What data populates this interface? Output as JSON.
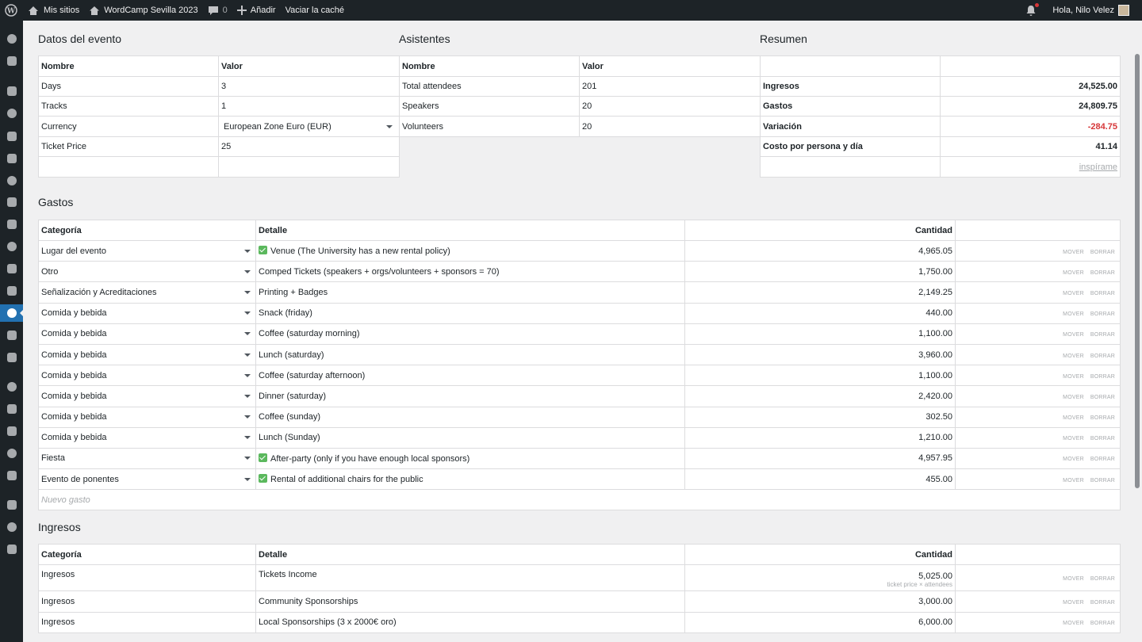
{
  "adminbar": {
    "my_sites": "Mis sitios",
    "site_name": "WordCamp Sevilla 2023",
    "comments_count": "0",
    "new_label": "Añadir",
    "flush_cache": "Vaciar la caché",
    "greeting": "Hola, Nilo Velez"
  },
  "event": {
    "title": "Datos del evento",
    "headers": [
      "Nombre",
      "Valor"
    ],
    "rows": [
      {
        "name": "Days",
        "value": "3"
      },
      {
        "name": "Tracks",
        "value": "1"
      },
      {
        "name": "Currency",
        "value": "European Zone Euro (EUR)"
      },
      {
        "name": "Ticket Price",
        "value": "25"
      }
    ]
  },
  "attendees": {
    "title": "Asistentes",
    "headers": [
      "Nombre",
      "Valor"
    ],
    "rows": [
      {
        "name": "Total attendees",
        "value": "201"
      },
      {
        "name": "Speakers",
        "value": "20"
      },
      {
        "name": "Volunteers",
        "value": "20"
      }
    ]
  },
  "summary": {
    "title": "Resumen",
    "rows": [
      {
        "name": "Ingresos",
        "value": "24,525.00"
      },
      {
        "name": "Gastos",
        "value": "24,809.75"
      },
      {
        "name": "Variación",
        "value": "-284.75"
      },
      {
        "name": "Costo por persona y día",
        "value": "41.14"
      }
    ],
    "inspire_link": "inspírame"
  },
  "expenses": {
    "title": "Gastos",
    "headers": {
      "category": "Categoría",
      "detail": "Detalle",
      "amount": "Cantidad"
    },
    "action_move": "MOVER",
    "action_delete": "BORRAR",
    "new_placeholder": "Nuevo gasto",
    "rows": [
      {
        "category": "Lugar del evento",
        "detail": "Venue (The University has a new rental policy)",
        "checked": true,
        "amount": "4,965.05"
      },
      {
        "category": "Otro",
        "detail": "Comped Tickets (speakers + orgs/volunteers + sponsors = 70)",
        "checked": false,
        "amount": "1,750.00"
      },
      {
        "category": "Señalización y Acreditaciones",
        "detail": "Printing + Badges",
        "checked": false,
        "amount": "2,149.25"
      },
      {
        "category": "Comida y bebida",
        "detail": "Snack (friday)",
        "checked": false,
        "amount": "440.00"
      },
      {
        "category": "Comida y bebida",
        "detail": "Coffee (saturday morning)",
        "checked": false,
        "amount": "1,100.00"
      },
      {
        "category": "Comida y bebida",
        "detail": "Lunch (saturday)",
        "checked": false,
        "amount": "3,960.00"
      },
      {
        "category": "Comida y bebida",
        "detail": "Coffee (saturday afternoon)",
        "checked": false,
        "amount": "1,100.00"
      },
      {
        "category": "Comida y bebida",
        "detail": "Dinner (saturday)",
        "checked": false,
        "amount": "2,420.00"
      },
      {
        "category": "Comida y bebida",
        "detail": "Coffee (sunday)",
        "checked": false,
        "amount": "302.50"
      },
      {
        "category": "Comida y bebida",
        "detail": "Lunch (Sunday)",
        "checked": false,
        "amount": "1,210.00"
      },
      {
        "category": "Fiesta",
        "detail": "After-party (only if you have enough local sponsors)",
        "checked": true,
        "amount": "4,957.95"
      },
      {
        "category": "Evento de ponentes",
        "detail": "Rental of additional chairs for the public",
        "checked": true,
        "amount": "455.00"
      }
    ]
  },
  "income": {
    "title": "Ingresos",
    "headers": {
      "category": "Categoría",
      "detail": "Detalle",
      "amount": "Cantidad"
    },
    "rows": [
      {
        "category": "Ingresos",
        "detail": "Tickets Income",
        "amount": "5,025.00",
        "hint": "ticket price × attendees"
      },
      {
        "category": "Ingresos",
        "detail": "Community Sponsorships",
        "amount": "3,000.00",
        "hint": ""
      },
      {
        "category": "Ingresos",
        "detail": "Local Sponsorships (3 x 2000€ oro)",
        "amount": "6,000.00",
        "hint": ""
      }
    ]
  },
  "sidebar_icons": [
    "dashboard-icon",
    "jetpack-icon",
    "posts-icon",
    "media-icon",
    "pages-icon",
    "feedback-icon",
    "layout-icon",
    "heart-icon",
    "community-icon",
    "comments-icon",
    "speakers-icon",
    "tools-icon",
    "budget-icon",
    "sponsors-icon",
    "folder-icon",
    "appearance-icon",
    "plugins-icon",
    "users-icon",
    "settings-icon",
    "site-health-icon",
    "edit-icon",
    "share-icon",
    "play-icon"
  ]
}
